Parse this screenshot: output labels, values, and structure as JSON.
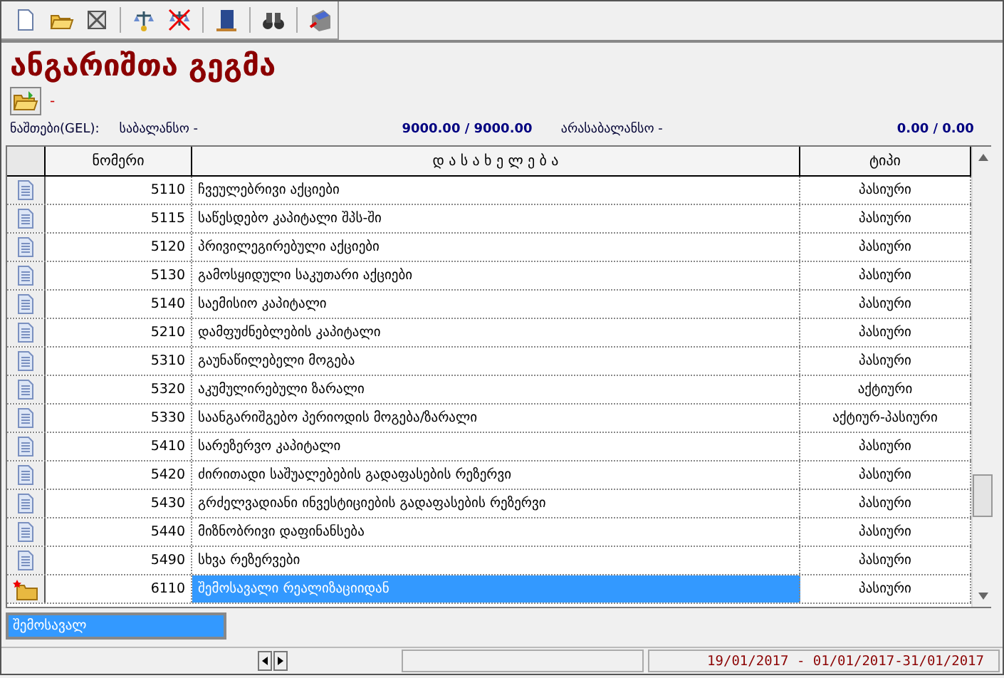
{
  "title": "ანგარიშთა გეგმა",
  "folder_label": "-",
  "balances": {
    "label": "ნაშთები(GEL):",
    "items": [
      {
        "label": "საბალანსო -",
        "value": "9000.00",
        "sep": "/",
        "value2": "9000.00"
      },
      {
        "label": "არასაბალანსო -",
        "value": "0.00",
        "sep": "/",
        "value2": "0.00"
      }
    ]
  },
  "table": {
    "columns": [
      "ნომერი",
      "დ ა ს ა ხ ე ლ ე ბ ა",
      "ტიპი"
    ],
    "rows": [
      {
        "kind": "document",
        "number": "5110",
        "name": "ჩვეულებრივი აქციები",
        "type": "პასიური",
        "selected": false
      },
      {
        "kind": "document",
        "number": "5115",
        "name": "საწესდებო კაპიტალი შპს-ში",
        "type": "პასიური",
        "selected": false
      },
      {
        "kind": "document",
        "number": "5120",
        "name": "პრივილეგირებული აქციები",
        "type": "პასიური",
        "selected": false
      },
      {
        "kind": "document",
        "number": "5130",
        "name": "გამოსყიდული საკუთარი აქციები",
        "type": "პასიური",
        "selected": false
      },
      {
        "kind": "document",
        "number": "5140",
        "name": "საემისიო კაპიტალი",
        "type": "პასიური",
        "selected": false
      },
      {
        "kind": "document",
        "number": "5210",
        "name": "დამფუძნებლების კაპიტალი",
        "type": "პასიური",
        "selected": false
      },
      {
        "kind": "document",
        "number": "5310",
        "name": "გაუნაწილებელი მოგება",
        "type": "პასიური",
        "selected": false
      },
      {
        "kind": "document",
        "number": "5320",
        "name": "აკუმულირებული ზარალი",
        "type": "აქტიური",
        "selected": false
      },
      {
        "kind": "document",
        "number": "5330",
        "name": "საანგარიშგებო პერიოდის მოგება/ზარალი",
        "type": "აქტიურ-პასიური",
        "selected": false
      },
      {
        "kind": "document",
        "number": "5410",
        "name": "სარეზერვო კაპიტალი",
        "type": "პასიური",
        "selected": false
      },
      {
        "kind": "document",
        "number": "5420",
        "name": "ძირითადი საშუალებების გადაფასების რეზერვი",
        "type": "პასიური",
        "selected": false
      },
      {
        "kind": "document",
        "number": "5430",
        "name": "გრძელვადიანი ინვესტიციების გადაფასების რეზერვი",
        "type": "პასიური",
        "selected": false
      },
      {
        "kind": "document",
        "number": "5440",
        "name": "მიზნობრივი დაფინანსება",
        "type": "პასიური",
        "selected": false
      },
      {
        "kind": "document",
        "number": "5490",
        "name": "სხვა რეზერვები",
        "type": "პასიური",
        "selected": false
      },
      {
        "kind": "folder",
        "number": "6110",
        "name": "შემოსავალი რეალიზაციიდან",
        "type": "პასიური",
        "selected": true
      }
    ]
  },
  "bottom_tab": {
    "label": "შემოსავალ",
    "selected": true
  },
  "status_bar": {
    "date": "19/01/2017 - 01/01/2017-31/01/2017"
  }
}
